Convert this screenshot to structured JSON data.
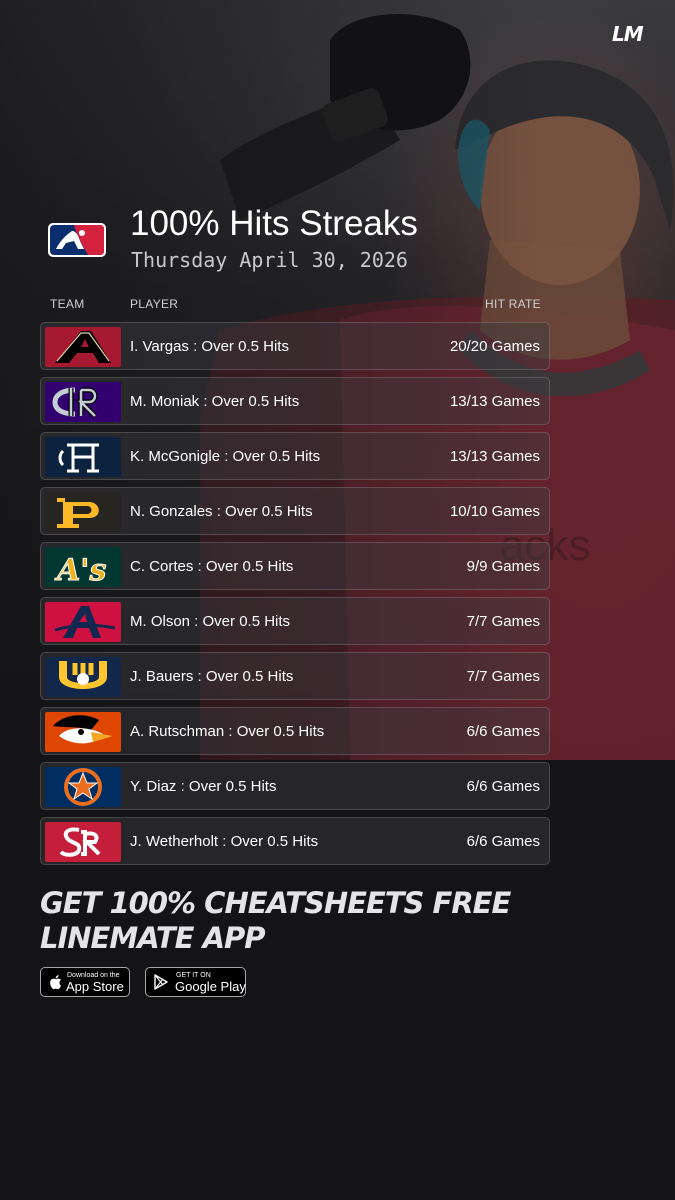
{
  "brand": {
    "logo_text": "LM"
  },
  "header": {
    "league_logo": "mlb-logo",
    "title": "100% Hits Streaks",
    "date": "Thursday April 30, 2026"
  },
  "columns": {
    "team": "TEAM",
    "player": "PLAYER",
    "hit_rate": "HIT RATE"
  },
  "rows": [
    {
      "team_logo": "arizona-diamondbacks-logo",
      "player": "I. Vargas : Over 0.5 Hits",
      "hit_rate": "20/20 Games"
    },
    {
      "team_logo": "colorado-rockies-logo",
      "player": "M. Moniak : Over 0.5 Hits",
      "hit_rate": "13/13 Games"
    },
    {
      "team_logo": "detroit-tigers-logo",
      "player": "K. McGonigle : Over 0.5 Hits",
      "hit_rate": "13/13 Games"
    },
    {
      "team_logo": "pittsburgh-pirates-logo",
      "player": "N. Gonzales : Over 0.5 Hits",
      "hit_rate": "10/10 Games"
    },
    {
      "team_logo": "athletics-logo",
      "player": "C. Cortes : Over 0.5 Hits",
      "hit_rate": "9/9 Games"
    },
    {
      "team_logo": "atlanta-braves-logo",
      "player": "M. Olson : Over 0.5 Hits",
      "hit_rate": "7/7 Games"
    },
    {
      "team_logo": "milwaukee-brewers-logo",
      "player": "J. Bauers : Over 0.5 Hits",
      "hit_rate": "7/7 Games"
    },
    {
      "team_logo": "baltimore-orioles-logo",
      "player": "A. Rutschman : Over 0.5 Hits",
      "hit_rate": "6/6 Games"
    },
    {
      "team_logo": "houston-astros-logo",
      "player": "Y. Diaz : Over 0.5 Hits",
      "hit_rate": "6/6 Games"
    },
    {
      "team_logo": "st-louis-cardinals-logo",
      "player": "J. Wetherholt : Over 0.5 Hits",
      "hit_rate": "6/6 Games"
    }
  ],
  "cta": {
    "line1": "GET 100% CHEATSHEETS FREE",
    "line2": "LINEMATE APP"
  },
  "app_store": {
    "small": "Download on the",
    "big": "App Store",
    "icon": "apple-icon"
  },
  "google_play": {
    "small": "GET IT ON",
    "big": "Google Play",
    "icon": "play-icon"
  },
  "colors": {
    "background": "#141416",
    "diamondbacks": "#a71930",
    "rockies": "#33006f",
    "tigers": "#0c2340",
    "pirates": "#27251f",
    "athletics": "#003831",
    "braves": "#ce1141",
    "brewers": "#12284b",
    "orioles": "#df4601",
    "astros": "#002d62",
    "cardinals": "#c41e3a"
  }
}
